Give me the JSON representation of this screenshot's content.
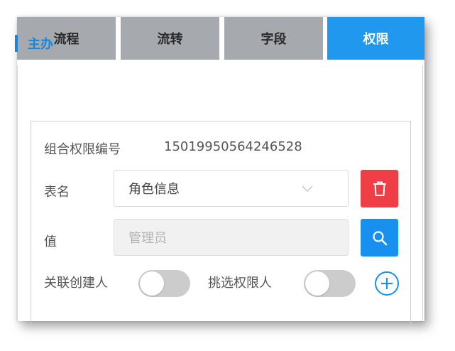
{
  "tabs": [
    {
      "label": "流程",
      "active": false
    },
    {
      "label": "流转",
      "active": false
    },
    {
      "label": "字段",
      "active": false
    },
    {
      "label": "权限",
      "active": true
    }
  ],
  "section": {
    "title": "主办"
  },
  "form": {
    "combo_id_label": "组合权限编号",
    "combo_id_value": "15019950564246528",
    "table_label": "表名",
    "table_value": "角色信息",
    "value_label": "值",
    "value_placeholder": "管理员",
    "link_creator_label": "关联创建人",
    "link_creator_on": false,
    "pick_person_label": "挑选权限人",
    "pick_person_on": false
  },
  "icons": {
    "chevron": "chevron-down-icon",
    "delete": "trash-icon",
    "search": "search-icon",
    "add": "plus-circle-icon"
  },
  "colors": {
    "accent": "#1f98ee",
    "tab_inactive": "#a6aaae",
    "danger": "#ef3e45",
    "primary": "#1890f0",
    "toggle_off": "#cccccc"
  }
}
